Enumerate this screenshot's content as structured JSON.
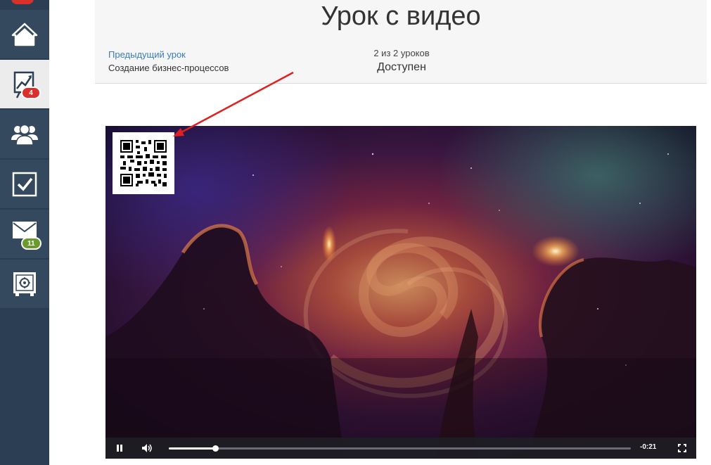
{
  "sidebar": {
    "items": [
      {
        "name": "home",
        "icon": "home-icon",
        "active": false
      },
      {
        "name": "courses",
        "icon": "chart-board-icon",
        "active": true,
        "badge": "4",
        "badge_color": "#d9302c"
      },
      {
        "name": "users",
        "icon": "users-icon",
        "active": false
      },
      {
        "name": "tasks",
        "icon": "checkbox-icon",
        "active": false
      },
      {
        "name": "messages",
        "icon": "envelope-icon",
        "active": false,
        "badge": "11",
        "badge_color": "#6a9a2c"
      },
      {
        "name": "safe",
        "icon": "safe-icon",
        "active": false
      }
    ]
  },
  "header": {
    "title": "Урок с видео",
    "prev_label": "Предыдущий урок",
    "prev_name": "Создание бизнес-процессов",
    "lesson_count": "2 из 2 уроков",
    "status": "Доступен"
  },
  "video": {
    "time_remaining": "-0:21",
    "progress": 0.1,
    "playing": true
  },
  "colors": {
    "sidebar_bg": "#2c3e53",
    "link": "#3a7bbf",
    "annotation_arrow": "#e02020"
  }
}
